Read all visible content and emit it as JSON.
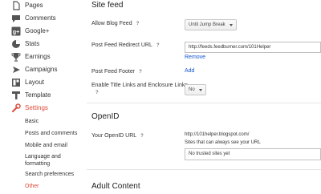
{
  "sidebar": {
    "items": [
      {
        "label": "Pages",
        "icon": "pages-icon"
      },
      {
        "label": "Comments",
        "icon": "comments-icon"
      },
      {
        "label": "Google+",
        "icon": "google-plus-icon"
      },
      {
        "label": "Stats",
        "icon": "stats-icon"
      },
      {
        "label": "Earnings",
        "icon": "earnings-icon"
      },
      {
        "label": "Campaigns",
        "icon": "campaigns-icon"
      },
      {
        "label": "Layout",
        "icon": "layout-icon"
      },
      {
        "label": "Template",
        "icon": "template-icon"
      },
      {
        "label": "Settings",
        "icon": "settings-icon",
        "active": true
      }
    ],
    "settings_subitems": [
      {
        "label": "Basic"
      },
      {
        "label": "Posts and comments"
      },
      {
        "label": "Mobile and email"
      },
      {
        "label": "Language and formatting"
      },
      {
        "label": "Search preferences"
      },
      {
        "label": "Other",
        "active": true
      }
    ],
    "active_color": "#dd4b39"
  },
  "main": {
    "site_feed": {
      "title": "Site feed",
      "allow_blog_feed_label": "Allow Blog Feed",
      "allow_blog_feed_value": "Until Jump Break",
      "post_feed_redirect_label": "Post Feed Redirect URL",
      "post_feed_redirect_value": "http://feeds.feedburner.com/101Helper",
      "remove_link": "Remove",
      "post_feed_footer_label": "Post Feed Footer",
      "add_link": "Add",
      "title_links_label": "Enable Title Links and Enclosure Links",
      "title_links_value": "No"
    },
    "openid": {
      "title": "OpenID",
      "url_label": "Your OpenID URL",
      "url_value": "http://101helper.blogspot.com/",
      "url_hint": "Sites that can always see your URL",
      "trusted_sites_text": "No trusted sites yet"
    },
    "adult_content": {
      "title": "Adult Content"
    },
    "help_glyph": "?",
    "link_color": "#1155cc"
  }
}
